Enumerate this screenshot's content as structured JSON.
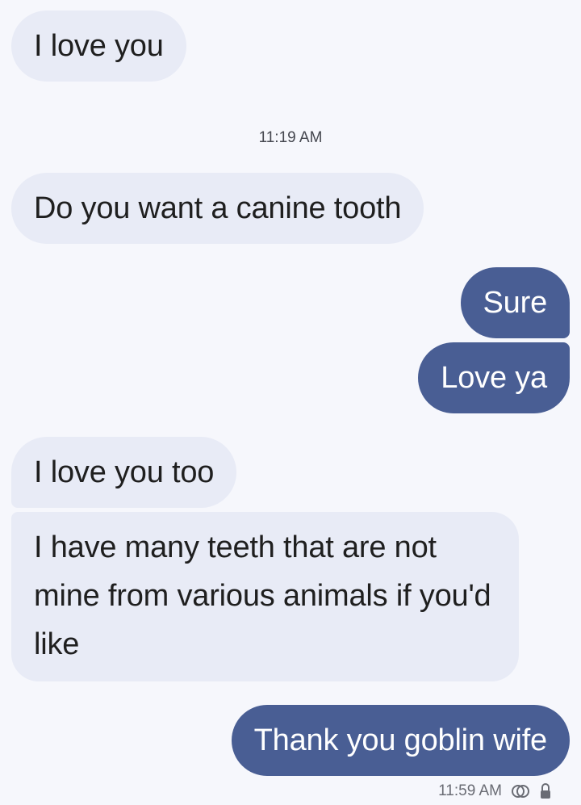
{
  "conversation": {
    "messages": [
      {
        "id": "m1",
        "direction": "incoming",
        "text": "I love you"
      },
      {
        "id": "m2",
        "direction": "incoming",
        "text": "Do you want a canine tooth"
      },
      {
        "id": "m3",
        "direction": "outgoing",
        "text": "Sure"
      },
      {
        "id": "m4",
        "direction": "outgoing",
        "text": "Love ya"
      },
      {
        "id": "m5",
        "direction": "incoming",
        "text": "I love you too"
      },
      {
        "id": "m6",
        "direction": "incoming",
        "text": "I have many teeth that are not mine from various animals if you'd like"
      },
      {
        "id": "m7",
        "direction": "outgoing",
        "text": "Thank you goblin wife"
      }
    ],
    "timestamps": {
      "divider": "11:19 AM",
      "footer": "11:59 AM"
    }
  },
  "colors": {
    "background": "#f6f7fc",
    "incoming_bubble": "#e8ebf6",
    "outgoing_bubble": "#495e94",
    "incoming_text": "#1f1f1f",
    "outgoing_text": "#ffffff"
  },
  "icons": {
    "delivered": "double-check-icon",
    "encryption": "lock-icon"
  }
}
